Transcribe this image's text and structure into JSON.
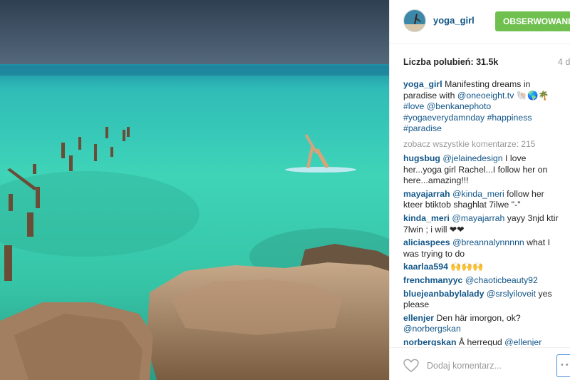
{
  "post": {
    "username": "yoga_girl",
    "follow_label": "OBSERWOWANIE",
    "likes_label": "Liczba polubień:",
    "likes_count": "31.5k",
    "time_ago": "4 d",
    "caption": {
      "user": "yoga_girl",
      "text_1": "Manifesting dreams in paradise with",
      "mention": "@oneoeight.tv",
      "emoji": "🐚🌎🌴",
      "tag_1": "#love",
      "mention_2": "@benkanephoto",
      "tag_2": "#yogaeverydamnday",
      "tag_3": "#happiness",
      "tag_4": "#paradise"
    },
    "view_all": "zobacz wszystkie komentarze: 215",
    "comments": [
      {
        "user": "hugsbug",
        "mention": "@jelainedesign",
        "text": "I love her...yoga girl Rachel...I follow her on here...amazing!!!"
      },
      {
        "user": "mayajarrah",
        "mention": "@kinda_meri",
        "text": "follow her kteer btiktob shaghlat 7ilwe \"-\""
      },
      {
        "user": "kinda_meri",
        "mention": "@mayajarrah",
        "text": "yayy 3njd ktir 7lwin ; i will ❤❤"
      },
      {
        "user": "aliciaspees",
        "mention": "@breannalynnnnn",
        "text": "what I was trying to do"
      },
      {
        "user": "kaarlaa594",
        "mention": "",
        "text": "🙌🙌🙌"
      },
      {
        "user": "frenchmanyyc",
        "mention": "@chaoticbeauty92",
        "text": ""
      },
      {
        "user": "bluejeanbabylalady",
        "mention": "@srslyiloveit",
        "text": "yes please"
      },
      {
        "user": "ellenjer",
        "mention": "",
        "text": "Den här imorgon, ok?",
        "mention_after": "@norbergskan"
      },
      {
        "user": "norbergskan",
        "mention": "",
        "text": "Å herregud",
        "mention_after": "@ellenjer"
      }
    ],
    "add_comment_placeholder": "Dodaj komentarz...",
    "more_label": "• •"
  },
  "colors": {
    "link": "#125688",
    "follow_bg": "#70c050",
    "muted": "#999999",
    "sea_turquoise": "#3fd0b4",
    "sky": "#3d4f63"
  },
  "icons": {
    "like": "heart-outline-icon",
    "avatar": "user-avatar"
  }
}
